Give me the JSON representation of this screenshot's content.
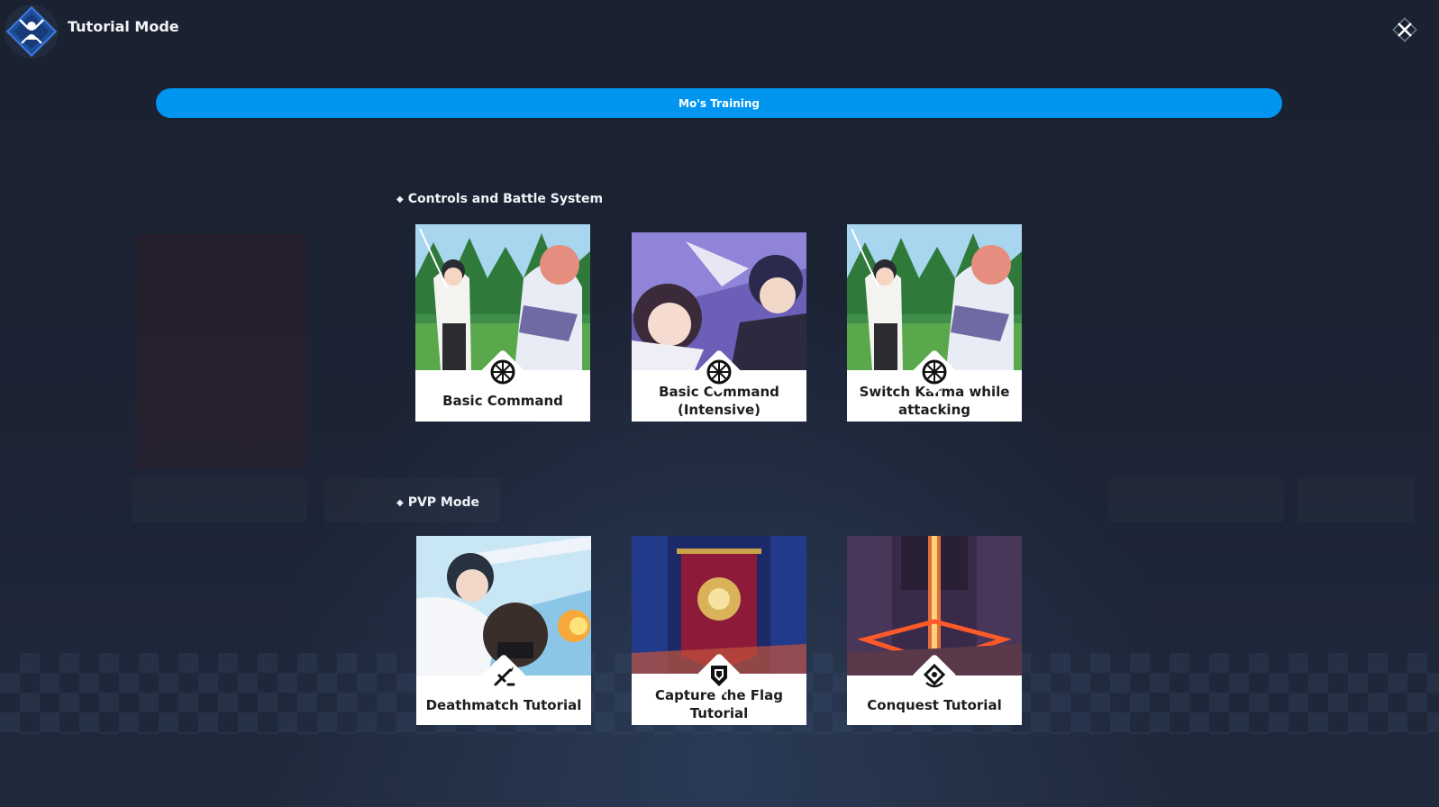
{
  "header": {
    "title": "Tutorial Mode"
  },
  "banner": {
    "label": "Mo's Training"
  },
  "sections": [
    {
      "title": "Controls and Battle System",
      "cards": [
        {
          "label": "Basic Command",
          "icon": "wheel-icon"
        },
        {
          "label": "Basic Command (Intensive)",
          "icon": "wheel-icon"
        },
        {
          "label": "Switch Karma while attacking",
          "icon": "wheel-icon"
        }
      ]
    },
    {
      "title": "PVP Mode",
      "cards": [
        {
          "label": "Deathmatch Tutorial",
          "icon": "crossed-swords-icon"
        },
        {
          "label": "Capture the Flag Tutorial",
          "icon": "shield-flag-icon"
        },
        {
          "label": "Conquest Tutorial",
          "icon": "conquest-marker-icon"
        }
      ]
    }
  ],
  "colors": {
    "background": "#1b2232",
    "accent_banner": "#0096f0",
    "card_label_bg": "#ffffff",
    "card_label_text": "#1d1d22"
  }
}
